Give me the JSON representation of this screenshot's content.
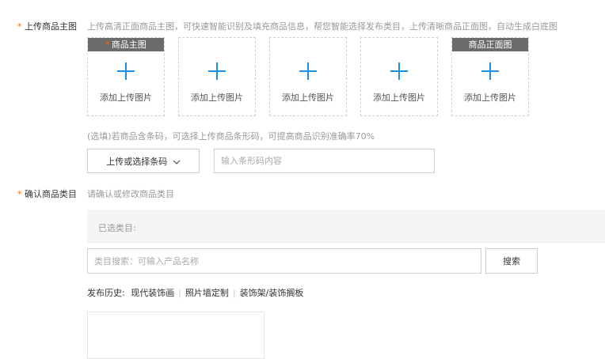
{
  "main_image": {
    "label": "上传商品主图",
    "hint": "上传高清正面商品主图，可快速智能识别及填充商品信息，帮您智能选择发布类目，上传清晰商品正面图，自动生成白底图",
    "slots": [
      {
        "tag": "商品主图",
        "tag_required": true,
        "text": "添加上传图片"
      },
      {
        "tag": "",
        "tag_required": false,
        "text": "添加上传图片"
      },
      {
        "tag": "",
        "tag_required": false,
        "text": "添加上传图片"
      },
      {
        "tag": "",
        "tag_required": false,
        "text": "添加上传图片"
      },
      {
        "tag": "商品正面图",
        "tag_required": false,
        "text": "添加上传图片"
      }
    ]
  },
  "barcode": {
    "hint": "(选填)若商品含条码，可选择上传商品条形码，可提高商品识别准确率70%",
    "button_label": "上传或选择条码",
    "placeholder": "输入条形码内容"
  },
  "category": {
    "label": "确认商品类目",
    "hint": "请确认或修改商品类目",
    "selected_label": "已选类目:",
    "search_placeholder": "类目搜索：可输入产品名称",
    "search_button": "搜索",
    "history_label": "发布历史:",
    "history_items": [
      "现代装饰画",
      "照片墙定制",
      "装饰架/装饰搁板"
    ]
  },
  "required_mark": "*",
  "colors": {
    "required": "#ff6a00",
    "accent": "#1a8fe3",
    "tag_bg": "#6b6b6b"
  }
}
